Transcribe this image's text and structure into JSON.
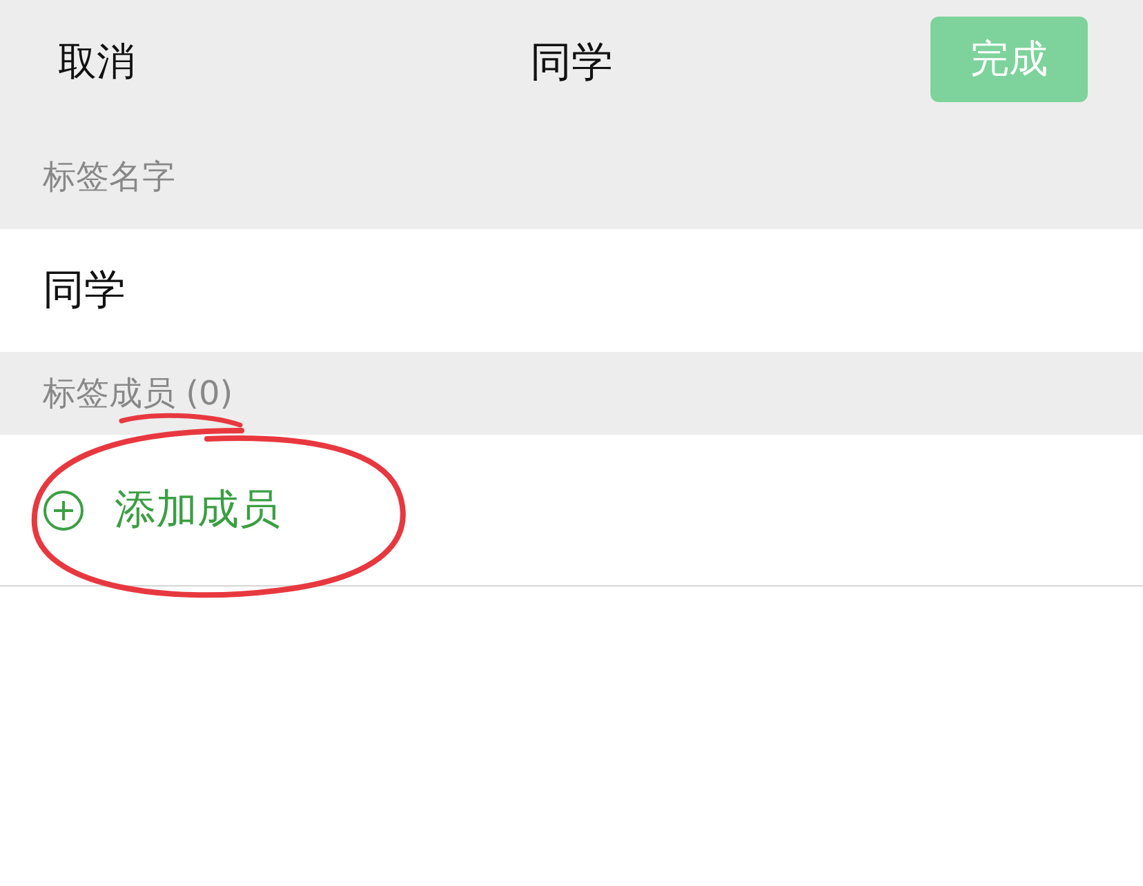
{
  "nav_bar": {
    "cancel": "取消",
    "title": "同学",
    "done_button": {
      "label": "完成",
      "disabled": true
    }
  },
  "name_section": {
    "header": "标签名字",
    "value": "同学"
  },
  "members_section": {
    "header": "标签成员 (0)",
    "add_member": "添加成员"
  },
  "annotation": {
    "underline": true,
    "circle": true
  }
}
